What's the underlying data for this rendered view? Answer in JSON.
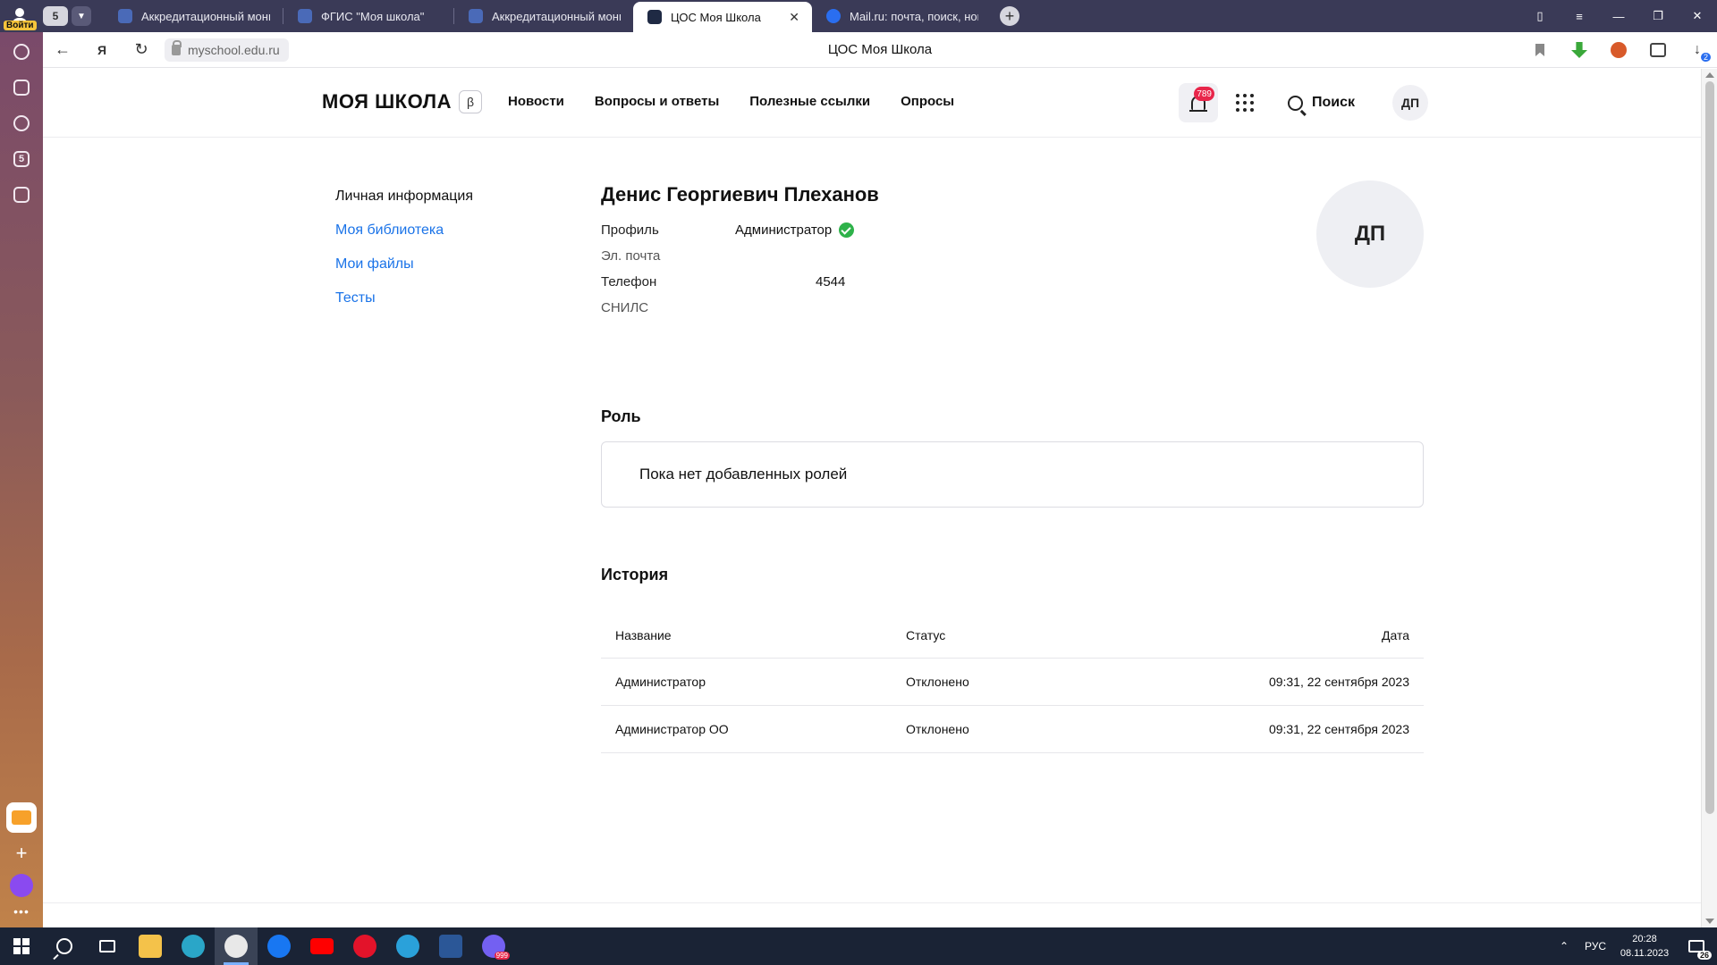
{
  "browser": {
    "login_label": "Войти",
    "tab_count": "5",
    "tabs": [
      {
        "title": "Аккредитационный монит",
        "favicon_color": "#4a6ab8"
      },
      {
        "title": "ФГИС \"Моя школа\"",
        "favicon_color": "#4a6ab8"
      },
      {
        "title": "Аккредитационный монит",
        "favicon_color": "#4a6ab8"
      },
      {
        "title": "ЦОС Моя Школа",
        "favicon_color": "#1f2a44"
      },
      {
        "title": "Mail.ru: почта, поиск, нов",
        "favicon_color": "#2a6ef0"
      }
    ],
    "url": "myschool.edu.ru",
    "page_title": "ЦОС Моя Школа",
    "downloads_badge": "2"
  },
  "site": {
    "logo": "МОЯ ШКОЛА",
    "beta": "β",
    "nav": [
      "Новости",
      "Вопросы и ответы",
      "Полезные ссылки",
      "Опросы"
    ],
    "notifications_count": "789",
    "search_label": "Поиск",
    "avatar_initials": "ДП"
  },
  "sidebar": {
    "items": [
      {
        "label": "Личная информация",
        "active": true
      },
      {
        "label": "Моя библиотека",
        "active": false
      },
      {
        "label": "Мои файлы",
        "active": false
      },
      {
        "label": "Тесты",
        "active": false
      }
    ]
  },
  "profile": {
    "full_name": "Денис Георгиевич Плеханов",
    "fields": {
      "profile_label": "Профиль",
      "profile_value": "Администратор",
      "email_label": "Эл. почта",
      "email_value": "",
      "phone_label": "Телефон",
      "phone_value": "4544",
      "snils_label": "СНИЛС",
      "snils_value": ""
    },
    "avatar_initials": "ДП"
  },
  "roles": {
    "title": "Роль",
    "empty_text": "Пока нет добавленных ролей"
  },
  "history": {
    "title": "История",
    "columns": {
      "name": "Название",
      "status": "Статус",
      "date": "Дата"
    },
    "rows": [
      {
        "name": "Администратор",
        "status": "Отклонено",
        "date": "09:31, 22 сентября 2023"
      },
      {
        "name": "Администратор ОО",
        "status": "Отклонено",
        "date": "09:31, 22 сентября 2023"
      }
    ]
  },
  "taskbar": {
    "lang": "РУС",
    "time": "20:28",
    "date": "08.11.2023",
    "notifications": "26",
    "viber_badge": "999"
  }
}
